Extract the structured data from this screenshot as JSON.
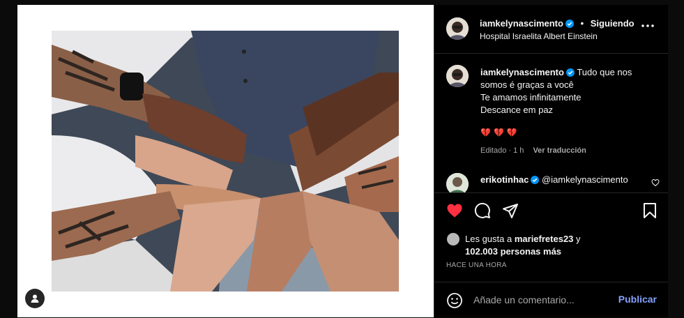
{
  "post": {
    "username": "iamkelynascimento",
    "separator": "•",
    "follow_label": "Siguiendo",
    "location": "Hospital Israelita Albert Einstein",
    "caption_lines": [
      "Tudo que nos",
      "somos é graças a você",
      "Te amamos infinitamente",
      "Descance em paz"
    ],
    "hearts": "💔💔💔",
    "edited": "Editado · 1 h",
    "translate": "Ver traducción"
  },
  "comment": {
    "username": "erikotinhac",
    "text": "@iamkelynascimento"
  },
  "likes": {
    "prefix": "Les gusta a",
    "user": "mariefretes23",
    "conj": "y",
    "others": "102.003 personas más"
  },
  "time_ago": "HACE UNA HORA",
  "comment_box": {
    "placeholder": "Añade un comentario...",
    "publish": "Publicar"
  },
  "icons": {
    "more": "more-icon",
    "like": "heart-filled-icon",
    "comment": "comment-icon",
    "share": "share-icon",
    "save": "bookmark-icon",
    "emoji": "emoji-icon",
    "tag": "user-tag-icon"
  },
  "colors": {
    "like_red": "#ff3040",
    "verified_blue": "#0095f6",
    "link_blue": "#85a1ff"
  }
}
